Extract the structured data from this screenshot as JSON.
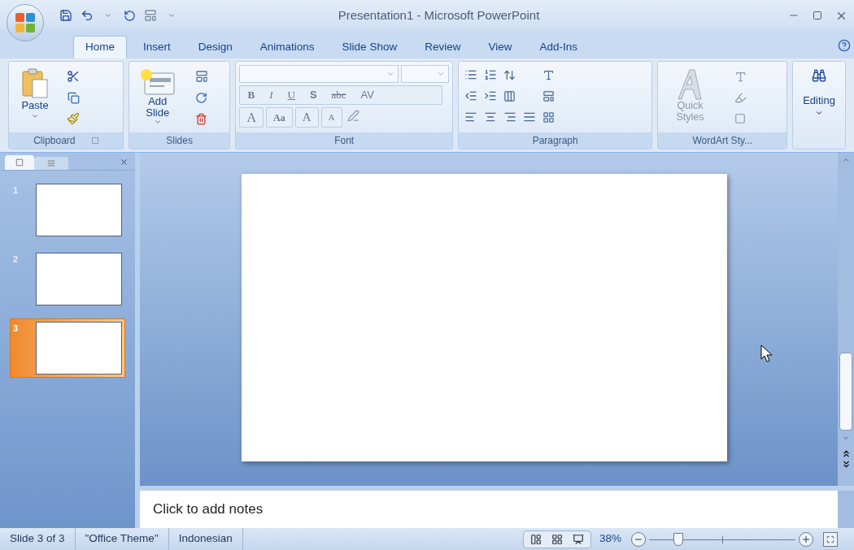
{
  "window": {
    "title": "Presentation1 - Microsoft PowerPoint"
  },
  "tabs": [
    {
      "label": "Home",
      "selected": true
    },
    {
      "label": "Insert",
      "selected": false
    },
    {
      "label": "Design",
      "selected": false
    },
    {
      "label": "Animations",
      "selected": false
    },
    {
      "label": "Slide Show",
      "selected": false
    },
    {
      "label": "Review",
      "selected": false
    },
    {
      "label": "View",
      "selected": false
    },
    {
      "label": "Add-Ins",
      "selected": false
    }
  ],
  "ribbon": {
    "clipboard": {
      "label": "Clipboard",
      "paste": "Paste"
    },
    "slides": {
      "label": "Slides",
      "add_slide": [
        "Add",
        "Slide"
      ]
    },
    "font": {
      "label": "Font",
      "row1": [
        "B",
        "I",
        "U",
        "S",
        "abc",
        "AV"
      ],
      "row2": [
        "A",
        "Aa",
        "A",
        "A"
      ]
    },
    "paragraph": {
      "label": "Paragraph"
    },
    "wordart": {
      "label": "WordArt Sty...",
      "quick_styles": [
        "Quick",
        "Styles"
      ]
    },
    "editing": {
      "label": "Editing"
    }
  },
  "slide_panel": {
    "slides": [
      {
        "number": "1",
        "selected": false
      },
      {
        "number": "2",
        "selected": false
      },
      {
        "number": "3",
        "selected": true
      }
    ]
  },
  "notes": {
    "placeholder": "Click to add notes"
  },
  "status_bar": {
    "items": [
      "Slide 3 of 3",
      "\"Office Theme\"",
      "Indonesian"
    ],
    "zoom": "38%",
    "zoom_slider": {
      "level": 0.2
    }
  }
}
